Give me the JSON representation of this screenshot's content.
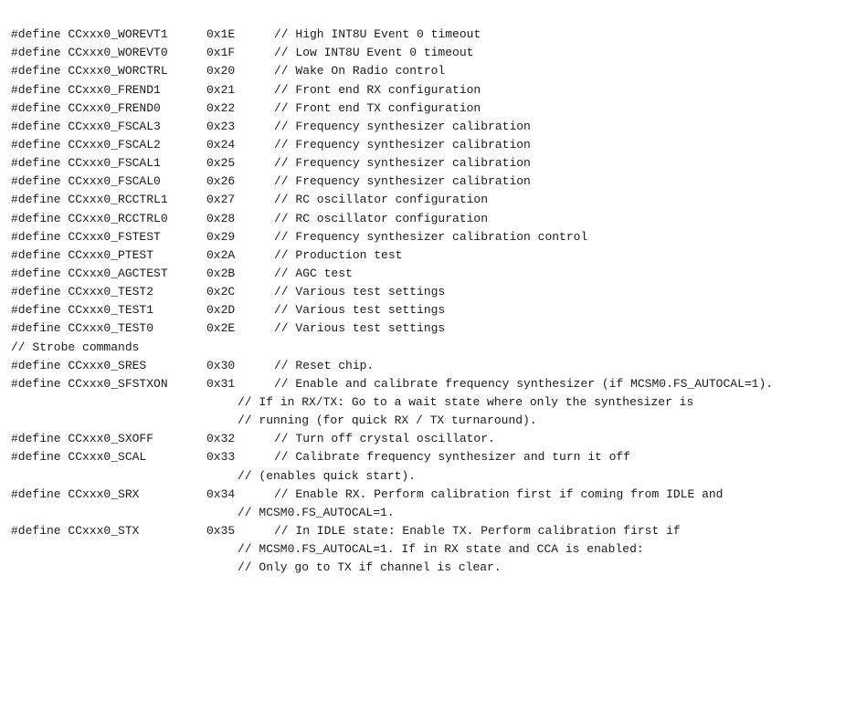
{
  "lines": [
    {
      "define": "#define CCxxx0_WOREVT1",
      "value": "0x1E",
      "comment": "// High INT8U Event 0 timeout"
    },
    {
      "define": "#define CCxxx0_WOREVT0",
      "value": "0x1F",
      "comment": "// Low INT8U Event 0 timeout"
    },
    {
      "define": "#define CCxxx0_WORCTRL",
      "value": "0x20",
      "comment": "// Wake On Radio control"
    },
    {
      "define": "#define CCxxx0_FREND1",
      "value": "0x21",
      "comment": "// Front end RX configuration"
    },
    {
      "define": "#define CCxxx0_FREND0",
      "value": "0x22",
      "comment": "// Front end TX configuration"
    },
    {
      "define": "#define CCxxx0_FSCAL3",
      "value": "0x23",
      "comment": "// Frequency synthesizer calibration"
    },
    {
      "define": "#define CCxxx0_FSCAL2",
      "value": "0x24",
      "comment": "// Frequency synthesizer calibration"
    },
    {
      "define": "#define CCxxx0_FSCAL1",
      "value": "0x25",
      "comment": "// Frequency synthesizer calibration"
    },
    {
      "define": "#define CCxxx0_FSCAL0",
      "value": "0x26",
      "comment": "// Frequency synthesizer calibration"
    },
    {
      "define": "#define CCxxx0_RCCTRL1",
      "value": "0x27",
      "comment": "// RC oscillator configuration"
    },
    {
      "define": "#define CCxxx0_RCCTRL0",
      "value": "0x28",
      "comment": "// RC oscillator configuration"
    },
    {
      "define": "#define CCxxx0_FSTEST",
      "value": "0x29",
      "comment": "// Frequency synthesizer calibration control"
    },
    {
      "define": "#define CCxxx0_PTEST",
      "value": "0x2A",
      "comment": "// Production test"
    },
    {
      "define": "#define CCxxx0_AGCTEST",
      "value": "0x2B",
      "comment": "// AGC test"
    },
    {
      "define": "#define CCxxx0_TEST2",
      "value": "0x2C",
      "comment": "// Various test settings"
    },
    {
      "define": "#define CCxxx0_TEST1",
      "value": "0x2D",
      "comment": "// Various test settings"
    },
    {
      "define": "#define CCxxx0_TEST0",
      "value": "0x2E",
      "comment": "// Various test settings"
    },
    {
      "type": "comment-only",
      "text": "// Strobe commands"
    },
    {
      "define": "#define CCxxx0_SRES",
      "value": "0x30",
      "comment": "// Reset chip."
    },
    {
      "type": "sfstxon",
      "define": "#define CCxxx0_SFSTXON",
      "value": "0x31",
      "comment": "// Enable and calibrate frequency synthesizer (if MCSM0.FS_AUTOCAL=1)."
    },
    {
      "type": "continuation",
      "text": "// If in RX/TX: Go to a wait state where only the synthesizer is"
    },
    {
      "type": "continuation",
      "text": "// running (for quick RX / TX turnaround)."
    },
    {
      "define": "#define CCxxx0_SXOFF",
      "value": "0x32",
      "comment": "// Turn off crystal oscillator."
    },
    {
      "type": "scal",
      "define": "#define CCxxx0_SCAL",
      "value": "0x33",
      "comment": "// Calibrate frequency synthesizer and turn it off"
    },
    {
      "type": "continuation",
      "text": "// (enables quick start)."
    },
    {
      "type": "srx",
      "define": "#define CCxxx0_SRX",
      "value": "0x34",
      "comment": "// Enable RX. Perform calibration first if coming from IDLE and"
    },
    {
      "type": "continuation",
      "text": "// MCSM0.FS_AUTOCAL=1."
    },
    {
      "type": "stx",
      "define": "#define CCxxx0_STX",
      "value": "0x35",
      "comment": "// In IDLE state: Enable TX. Perform calibration first if"
    },
    {
      "type": "continuation",
      "text": "// MCSM0.FS_AUTOCAL=1. If in RX state and CCA is enabled:"
    },
    {
      "type": "continuation",
      "text": "// Only go to TX if channel is clear."
    }
  ]
}
